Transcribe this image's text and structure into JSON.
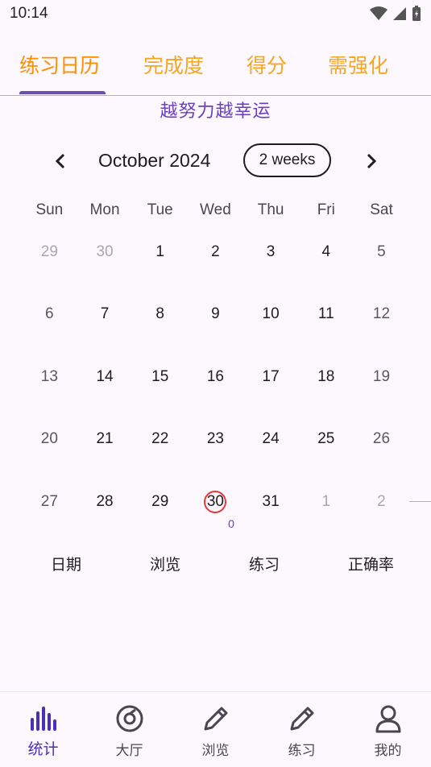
{
  "status_bar": {
    "time": "10:14"
  },
  "tabs": [
    {
      "label": "练习日历",
      "active": true
    },
    {
      "label": "完成度",
      "active": false
    },
    {
      "label": "得分",
      "active": false
    },
    {
      "label": "需强化",
      "active": false
    }
  ],
  "motto": "越努力越幸运",
  "calendar": {
    "month_title": "October 2024",
    "format_button": "2 weeks",
    "weekdays": [
      "Sun",
      "Mon",
      "Tue",
      "Wed",
      "Thu",
      "Fri",
      "Sat"
    ],
    "weeks": [
      [
        {
          "d": "29",
          "out": true
        },
        {
          "d": "30",
          "out": true
        },
        {
          "d": "1"
        },
        {
          "d": "2"
        },
        {
          "d": "3"
        },
        {
          "d": "4"
        },
        {
          "d": "5"
        }
      ],
      [
        {
          "d": "6"
        },
        {
          "d": "7"
        },
        {
          "d": "8"
        },
        {
          "d": "9"
        },
        {
          "d": "10"
        },
        {
          "d": "11"
        },
        {
          "d": "12"
        }
      ],
      [
        {
          "d": "13"
        },
        {
          "d": "14"
        },
        {
          "d": "15"
        },
        {
          "d": "16"
        },
        {
          "d": "17"
        },
        {
          "d": "18"
        },
        {
          "d": "19"
        }
      ],
      [
        {
          "d": "20"
        },
        {
          "d": "21"
        },
        {
          "d": "22"
        },
        {
          "d": "23"
        },
        {
          "d": "24"
        },
        {
          "d": "25"
        },
        {
          "d": "26"
        }
      ],
      [
        {
          "d": "27"
        },
        {
          "d": "28"
        },
        {
          "d": "29"
        },
        {
          "d": "30",
          "today": true,
          "marker": "0"
        },
        {
          "d": "31"
        },
        {
          "d": "1",
          "out": true
        },
        {
          "d": "2",
          "out": true
        }
      ]
    ]
  },
  "table_headers": [
    "日期",
    "浏览",
    "练习",
    "正确率"
  ],
  "bottom_nav": [
    {
      "label": "统计",
      "icon": "bar-chart-icon",
      "active": true
    },
    {
      "label": "大厅",
      "icon": "disc-icon",
      "active": false
    },
    {
      "label": "浏览",
      "icon": "pencil-icon",
      "active": false
    },
    {
      "label": "练习",
      "icon": "pencil-icon",
      "active": false
    },
    {
      "label": "我的",
      "icon": "person-icon",
      "active": false
    }
  ],
  "colors": {
    "accent_orange": "#ff8f00",
    "accent_purple": "#6a3fc2",
    "today_ring": "#e53935"
  }
}
